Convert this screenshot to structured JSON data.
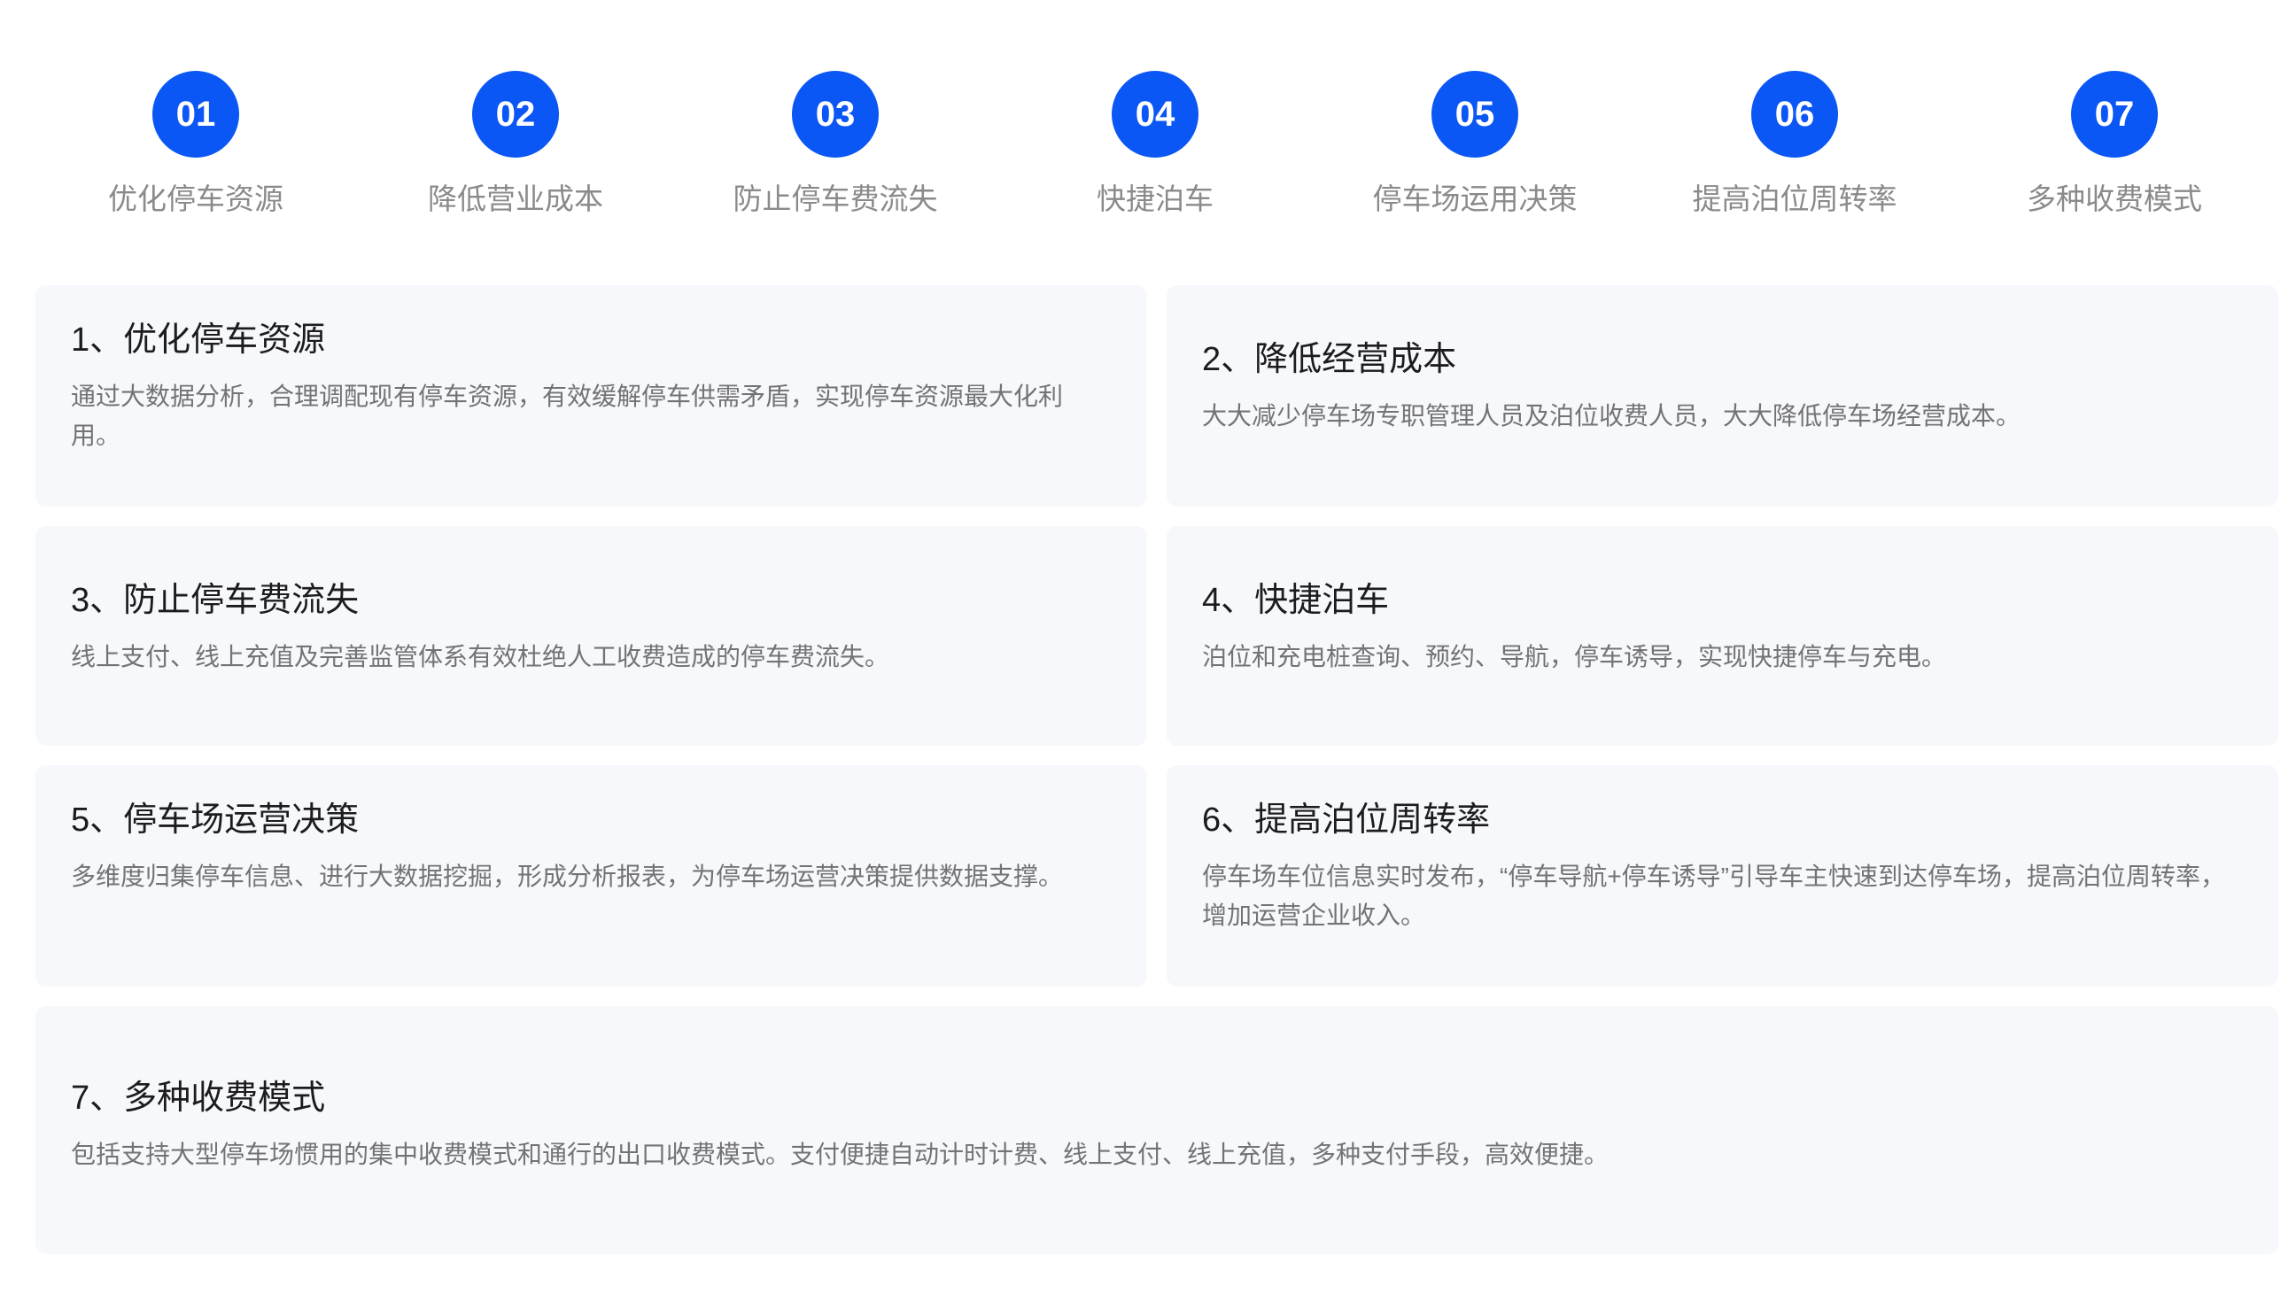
{
  "colors": {
    "accent": "#0b57f5",
    "card_background": "#f6f8fc",
    "title_text": "#1c1c1c",
    "muted_text": "#8a8a8a"
  },
  "steps": [
    {
      "number": "01",
      "label": "优化停车资源"
    },
    {
      "number": "02",
      "label": "降低营业成本"
    },
    {
      "number": "03",
      "label": "防止停车费流失"
    },
    {
      "number": "04",
      "label": "快捷泊车"
    },
    {
      "number": "05",
      "label": "停车场运用决策"
    },
    {
      "number": "06",
      "label": "提高泊位周转率"
    },
    {
      "number": "07",
      "label": "多种收费模式"
    }
  ],
  "cards": [
    {
      "title": "1、优化停车资源",
      "description": "通过大数据分析，合理调配现有停车资源，有效缓解停车供需矛盾，实现停车资源最大化利用。"
    },
    {
      "title": "2、降低经营成本",
      "description": "大大减少停车场专职管理人员及泊位收费人员，大大降低停车场经营成本。"
    },
    {
      "title": "3、防止停车费流失",
      "description": "线上支付、线上充值及完善监管体系有效杜绝人工收费造成的停车费流失。"
    },
    {
      "title": "4、快捷泊车",
      "description": "泊位和充电桩查询、预约、导航，停车诱导，实现快捷停车与充电。"
    },
    {
      "title": "5、停车场运营决策",
      "description": "多维度归集停车信息、进行大数据挖掘，形成分析报表，为停车场运营决策提供数据支撑。"
    },
    {
      "title": "6、提高泊位周转率",
      "description": "停车场车位信息实时发布，“停车导航+停车诱导”引导车主快速到达停车场，提高泊位周转率，增加运营企业收入。"
    },
    {
      "title": "7、多种收费模式",
      "description": "包括支持大型停车场惯用的集中收费模式和通行的出口收费模式。支付便捷自动计时计费、线上支付、线上充值，多种支付手段，高效便捷。"
    }
  ]
}
